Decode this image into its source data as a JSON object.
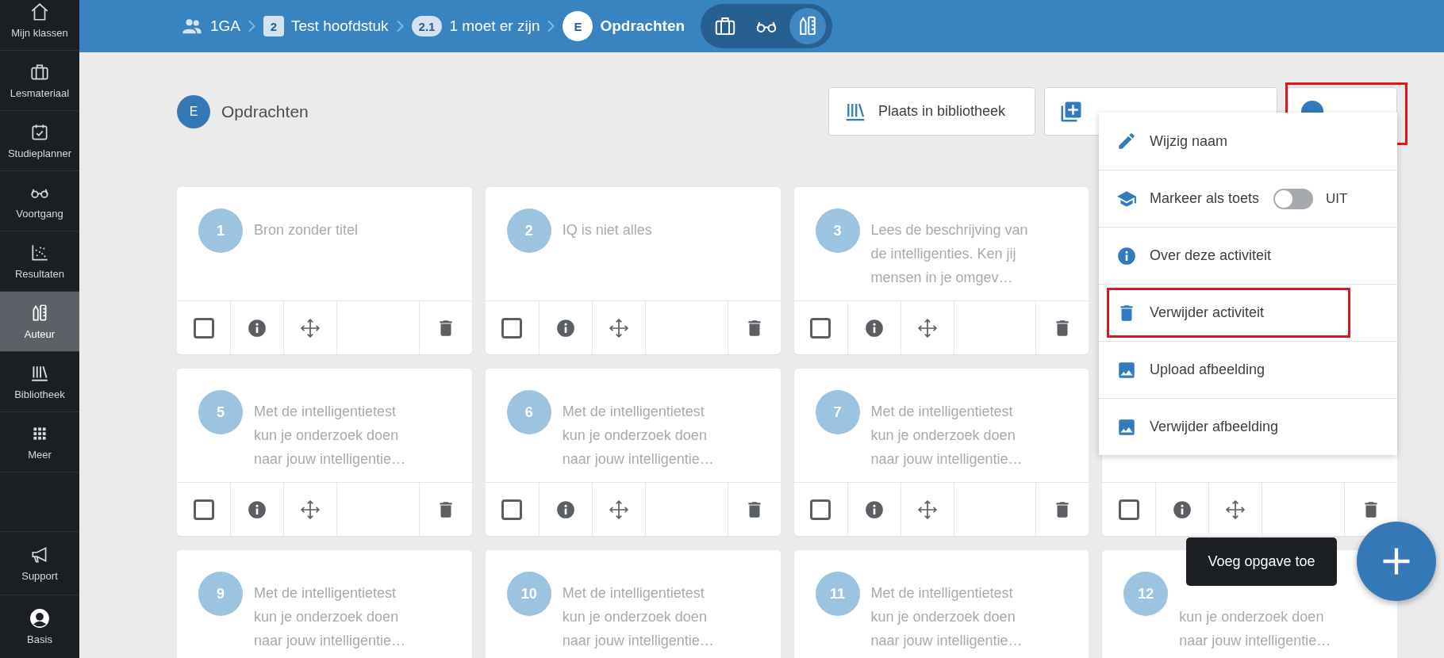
{
  "sidebar": {
    "items": [
      {
        "label": "Mijn klassen",
        "selected": false
      },
      {
        "label": "Lesmateriaal",
        "selected": false
      },
      {
        "label": "Studieplanner",
        "selected": false
      },
      {
        "label": "Voortgang",
        "selected": false
      },
      {
        "label": "Resultaten",
        "selected": false
      },
      {
        "label": "Auteur",
        "selected": true
      },
      {
        "label": "Bibliotheek",
        "selected": false
      },
      {
        "label": "Meer",
        "selected": false
      }
    ],
    "bottom_items": [
      {
        "label": "Support"
      },
      {
        "label": "Basis"
      }
    ]
  },
  "breadcrumb": [
    {
      "kind": "group",
      "label": "1GA"
    },
    {
      "kind": "chapter",
      "badge": "2",
      "label": "Test hoofdstuk"
    },
    {
      "kind": "section",
      "badge": "2.1",
      "label": "1 moet er zijn"
    },
    {
      "kind": "current",
      "badge": "E",
      "label": "Opdrachten"
    }
  ],
  "view_switch": [
    {
      "selected": false
    },
    {
      "selected": false
    },
    {
      "selected": true
    }
  ],
  "header": {
    "badge": "E",
    "title": "Opdrachten"
  },
  "actions": [
    {
      "kind": "library",
      "label": "Plaats in bibliotheek"
    },
    {
      "kind": "add"
    },
    {
      "kind": "more",
      "highlighted": true
    }
  ],
  "menu": [
    {
      "kind": "action",
      "label": "Wijzig naam"
    },
    {
      "kind": "toggle",
      "label": "Markeer als toets",
      "on": false,
      "state_label": "UIT"
    },
    {
      "kind": "action",
      "label": "Over deze activiteit"
    },
    {
      "kind": "action",
      "label": "Verwijder activiteit",
      "highlighted": true
    },
    {
      "kind": "action",
      "label": "Upload afbeelding"
    },
    {
      "kind": "action",
      "label": "Verwijder afbeelding"
    }
  ],
  "card_rows": [
    [
      {
        "number": "1",
        "lines": [
          "Bron zonder titel"
        ],
        "checked": false
      },
      {
        "number": "2",
        "lines": [
          "IQ is niet alles"
        ],
        "checked": false
      },
      {
        "number": "3",
        "lines": [
          "Lees de beschrijving van",
          "de intelligenties. Ken jij",
          "mensen in je omgev…"
        ],
        "checked": false
      },
      null
    ],
    [
      {
        "number": "5",
        "lines": [
          "Met de intelligentietest",
          "kun je onderzoek doen",
          "naar jouw intelligentie…"
        ],
        "checked": false
      },
      {
        "number": "6",
        "lines": [
          "Met de intelligentietest",
          "kun je onderzoek doen",
          "naar jouw intelligentie…"
        ],
        "checked": false
      },
      {
        "number": "7",
        "lines": [
          "Met de intelligentietest",
          "kun je onderzoek doen",
          "naar jouw intelligentie…"
        ],
        "checked": false
      },
      {
        "checked": false
      }
    ],
    [
      {
        "number": "9",
        "lines": [
          "Met de intelligentietest",
          "kun je onderzoek doen",
          "naar jouw intelligentie…"
        ]
      },
      {
        "number": "10",
        "lines": [
          "Met de intelligentietest",
          "kun je onderzoek doen",
          "naar jouw intelligentie…"
        ]
      },
      {
        "number": "11",
        "lines": [
          "Met de intelligentietest",
          "kun je onderzoek doen",
          "naar jouw intelligentie…"
        ]
      },
      {
        "number": "12",
        "first_line_covered": true,
        "lines": [
          "kun je onderzoek doen",
          "naar jouw intelligentie…"
        ]
      }
    ]
  ],
  "tooltip": "Voeg opgave toe"
}
